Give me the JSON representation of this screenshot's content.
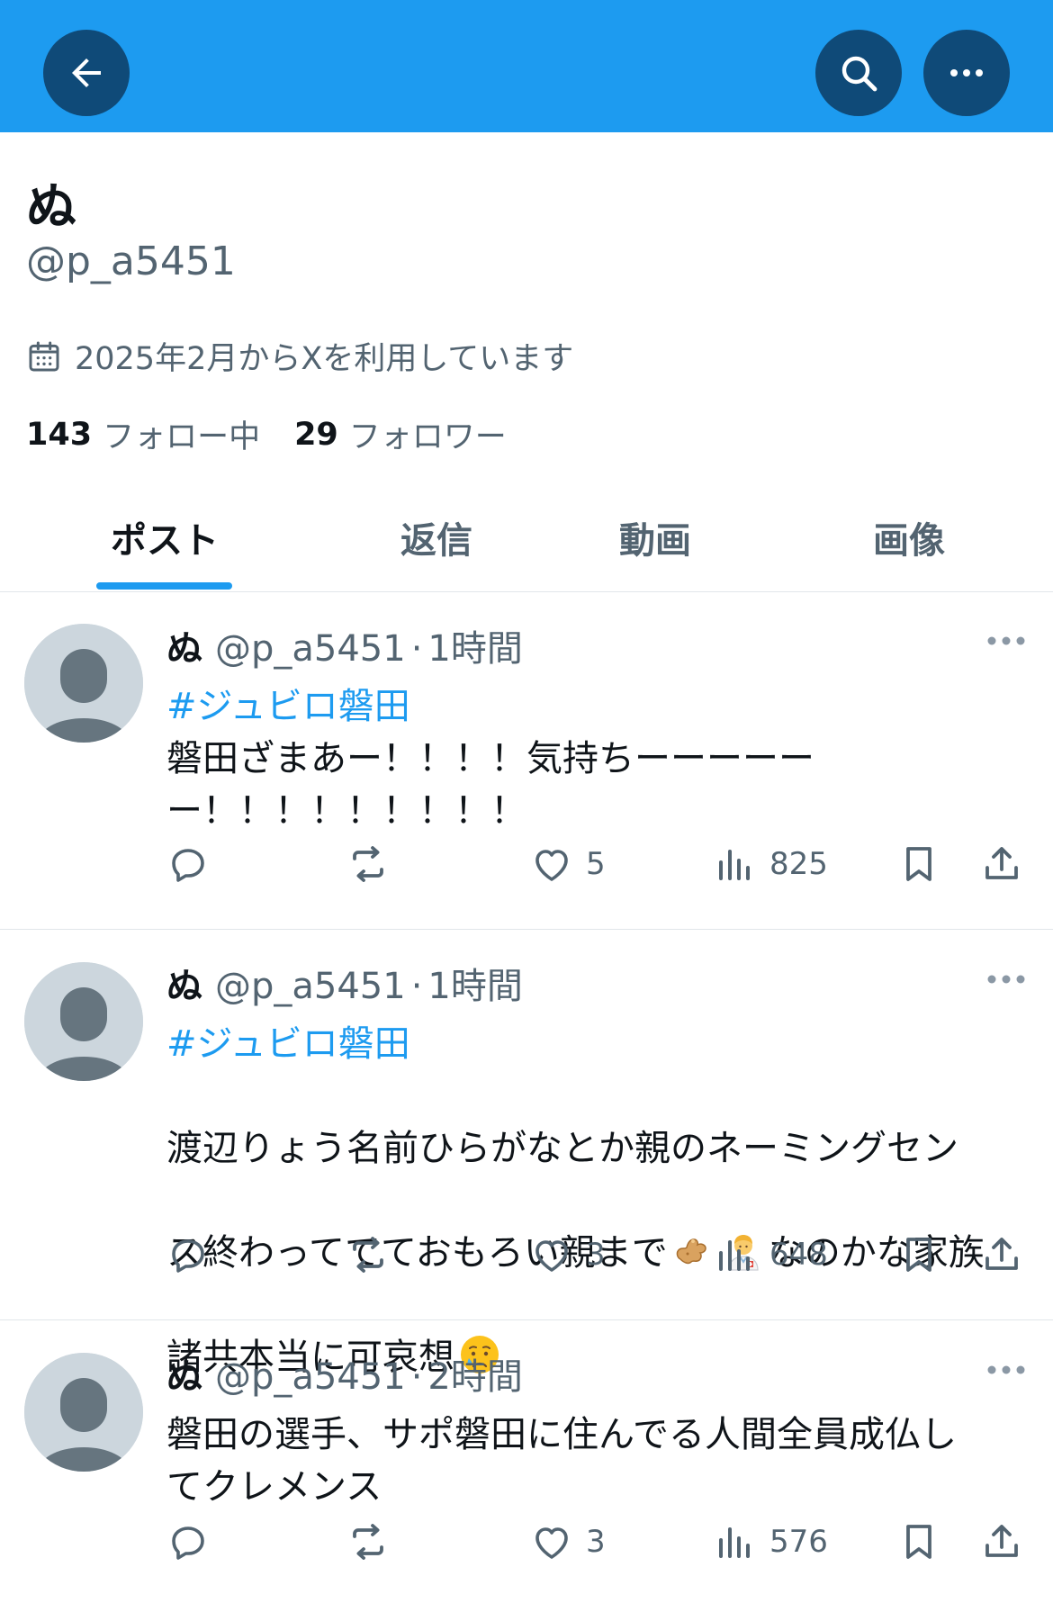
{
  "header": {
    "back_icon": "arrow-left-icon",
    "search_icon": "search-icon",
    "more_icon": "more-horizontal-icon",
    "bg_color": "#1d9bf0",
    "button_color": "#0f4a78"
  },
  "profile": {
    "display_name": "ぬ",
    "handle": "@p_a5451",
    "joined": "2025年2月からXを利用しています",
    "following_count": "143",
    "following_label": "フォロー中",
    "followers_count": "29",
    "followers_label": "フォロワー"
  },
  "tabs": [
    {
      "label": "ポスト",
      "active": true
    },
    {
      "label": "返信",
      "active": false
    },
    {
      "label": "動画",
      "active": false
    },
    {
      "label": "画像",
      "active": false
    }
  ],
  "posts": [
    {
      "name": "ぬ",
      "handle": "@p_a5451",
      "dot": "·",
      "time": "1時間",
      "hashtag": "#ジュビロ磐田",
      "text": "磐田ざまあー！！！！気持ちーーーーー\nー！！！！！！！！！",
      "likes": "5",
      "views": "825"
    },
    {
      "name": "ぬ",
      "handle": "@p_a5451",
      "dot": "·",
      "time": "1時間",
      "hashtag": "#ジュビロ磐田",
      "text_line1": "渡辺りょう名前ひらがなとか親のネーミングセン",
      "text_line2a": "ス終わっててておもろい親まで",
      "text_line2b": "なのかな家族",
      "text_line3": "諸共本当に可哀想",
      "emojis": [
        "ginger-emoji",
        "health-worker-emoji",
        "crying-face-emoji"
      ],
      "likes": "3",
      "views": "648"
    },
    {
      "name": "ぬ",
      "handle": "@p_a5451",
      "dot": "·",
      "time": "2時間",
      "text": "磐田の選手、サポ磐田に住んでる人間全員成仏し\nてクレメンス",
      "likes": "3",
      "views": "576"
    }
  ]
}
